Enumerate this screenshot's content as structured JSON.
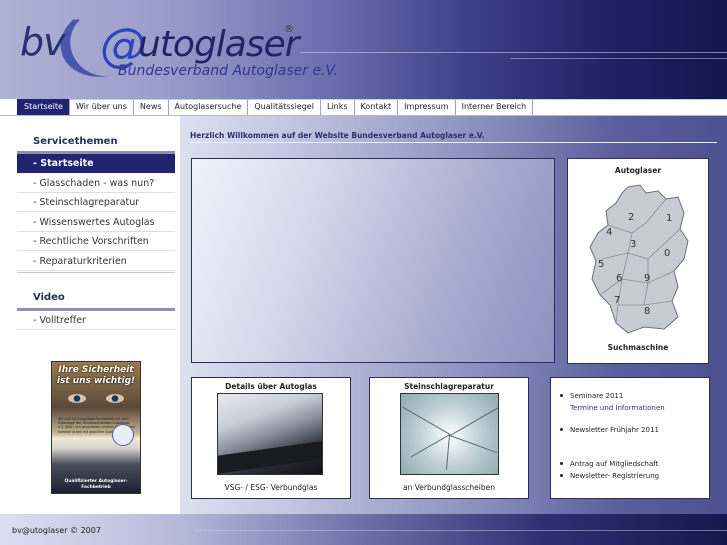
{
  "header": {
    "logo_bv": "bv",
    "logo_at": "@",
    "logo_rest": "utoglaser",
    "logo_registered": "®",
    "logo_subtitle": "Bundesverband Autoglaser e.V."
  },
  "nav": {
    "tabs": [
      {
        "label": "Startseite",
        "active": true
      },
      {
        "label": "Wir über uns"
      },
      {
        "label": "News"
      },
      {
        "label": "Autoglasersuche"
      },
      {
        "label": "Qualitätssiegel"
      },
      {
        "label": "Links"
      },
      {
        "label": "Kontakt"
      },
      {
        "label": "Impressum"
      },
      {
        "label": "Interner Bereich"
      }
    ]
  },
  "sidebar": {
    "section1_title": "Servicethemen",
    "section1_items": [
      {
        "label": "- Startseite",
        "active": true
      },
      {
        "label": "- Glasschaden - was nun?"
      },
      {
        "label": "- Steinschlagreparatur"
      },
      {
        "label": "- Wissenswertes Autoglas"
      },
      {
        "label": "- Rechtliche Vorschriften"
      },
      {
        "label": "- Reparaturkriterien"
      }
    ],
    "section2_title": "Video",
    "section2_items": [
      {
        "label": "- Volltreffer"
      }
    ],
    "promo": {
      "title": "Ihre Sicherheit ist uns wichtig!",
      "text": "Wir sind als Autoglaser-Fachbetrieb mit dem Gütesiegel des Bundesverbandes Autoglaser e.V. (BAV) und garantieren unseren Kunden eine korrekte Arbeit mit geprüfter Qualität!",
      "footer": "Qualifizierter Autoglaser-Fachbetrieb"
    }
  },
  "main": {
    "welcome": "Herzlich Willkommen auf der Website Bundesverband Autoglaser e.V.",
    "map_box": {
      "title": "Autoglaser",
      "caption": "Suchmaschine",
      "regions": [
        "2",
        "1",
        "4",
        "3",
        "5",
        "0",
        "6",
        "9",
        "7",
        "8"
      ]
    },
    "details_box": {
      "title": "Details über Autoglas",
      "caption": "VSG- / ESG- Verbundglas"
    },
    "stein_box": {
      "title": "Steinschlagreparatur",
      "caption": "an Verbundglasscheiben"
    },
    "links_box": {
      "seminare": "Seminare 2011",
      "seminare_sub": "Termine und Informationen",
      "newsletter": "Newsletter Frühjahr 2011",
      "antrag": "Antrag auf Mitgliedschaft",
      "registrierung": "Newsletter- Registrierung"
    }
  },
  "footer": {
    "copyright": "bv@utoglaser © 2007"
  },
  "colors": {
    "nav_active": "#1f2570",
    "link_blue": "#2a2f9a",
    "header_dark": "#14174f"
  }
}
